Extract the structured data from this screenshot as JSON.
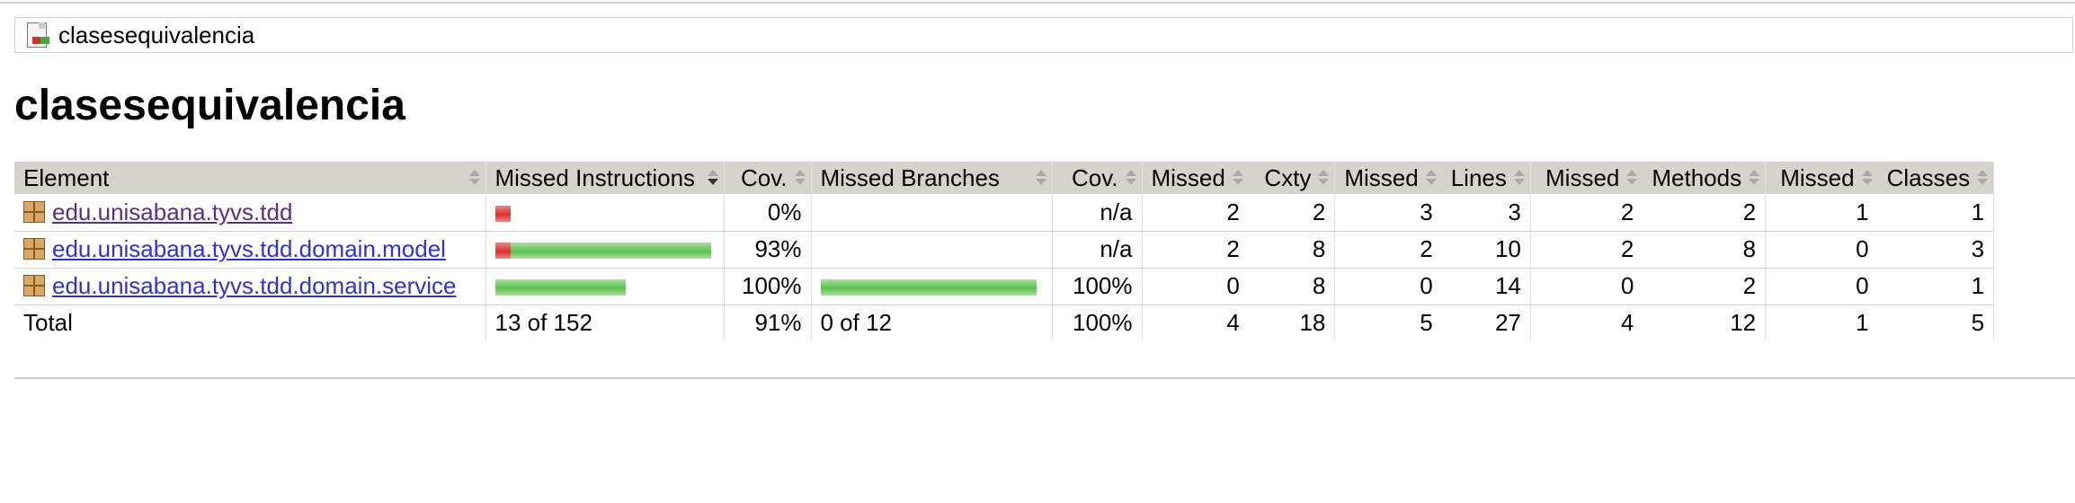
{
  "breadcrumb": {
    "label": "clasesequivalencia",
    "icon": "report-session-icon"
  },
  "page_title": "clasesequivalencia",
  "colors": {
    "header_bg": "#d6d3ce",
    "bar_red": "#d83030",
    "bar_green": "#5cbf4f",
    "link": "#3333cc"
  },
  "columns": [
    "Element",
    "Missed Instructions",
    "Cov.",
    "Missed Branches",
    "Cov.",
    "Missed",
    "Cxty",
    "Missed",
    "Lines",
    "Missed",
    "Methods",
    "Missed",
    "Classes"
  ],
  "rows": [
    {
      "element": "edu.unisabana.tyvs.tdd",
      "instr_missed": 13,
      "instr_total": 13,
      "instr_cov": "0%",
      "branch_missed": 0,
      "branch_total": 0,
      "branch_cov": "n/a",
      "cxty_missed": "2",
      "cxty": "2",
      "lines_missed": "3",
      "lines": "3",
      "methods_missed": "2",
      "methods": "2",
      "classes_missed": "1",
      "classes": "1"
    },
    {
      "element": "edu.unisabana.tyvs.tdd.domain.model",
      "instr_missed": 13,
      "instr_total": 180,
      "instr_cov": "93%",
      "branch_missed": 0,
      "branch_total": 0,
      "branch_cov": "n/a",
      "cxty_missed": "2",
      "cxty": "8",
      "lines_missed": "2",
      "lines": "10",
      "methods_missed": "2",
      "methods": "8",
      "classes_missed": "0",
      "classes": "3"
    },
    {
      "element": "edu.unisabana.tyvs.tdd.domain.service",
      "instr_missed": 0,
      "instr_total": 109,
      "instr_cov": "100%",
      "branch_missed": 0,
      "branch_total": 12,
      "branch_cov": "100%",
      "cxty_missed": "0",
      "cxty": "8",
      "lines_missed": "0",
      "lines": "14",
      "methods_missed": "0",
      "methods": "2",
      "classes_missed": "0",
      "classes": "1"
    }
  ],
  "total": {
    "label": "Total",
    "instr": "13 of 152",
    "instr_cov": "91%",
    "branch": "0 of 12",
    "branch_cov": "100%",
    "cxty_missed": "4",
    "cxty": "18",
    "lines_missed": "5",
    "lines": "27",
    "methods_missed": "4",
    "methods": "12",
    "classes_missed": "1",
    "classes": "5"
  }
}
